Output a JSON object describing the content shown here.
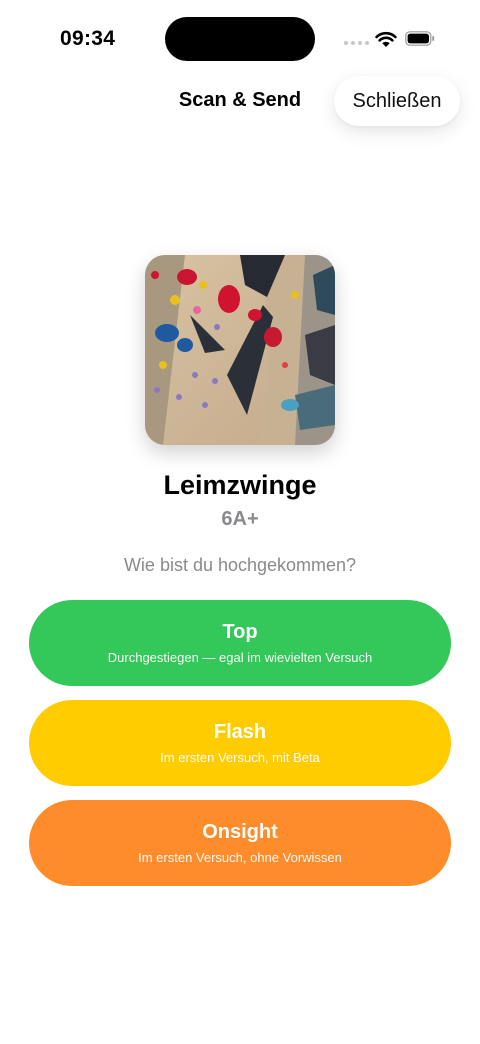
{
  "status_bar": {
    "time": "09:34"
  },
  "nav": {
    "title": "Scan & Send",
    "close_label": "Schließen"
  },
  "route": {
    "name": "Leimzwinge",
    "grade": "6A+"
  },
  "question": "Wie bist du hochgekommen?",
  "options": [
    {
      "label": "Top",
      "subtitle": "Durchgestiegen — egal im wievielten Versuch",
      "color": "#34c759"
    },
    {
      "label": "Flash",
      "subtitle": "Im ersten Versuch, mit Beta",
      "color": "#ffcc00"
    },
    {
      "label": "Onsight",
      "subtitle": "Im ersten Versuch, ohne Vorwissen",
      "color": "#ff8c2a"
    }
  ]
}
